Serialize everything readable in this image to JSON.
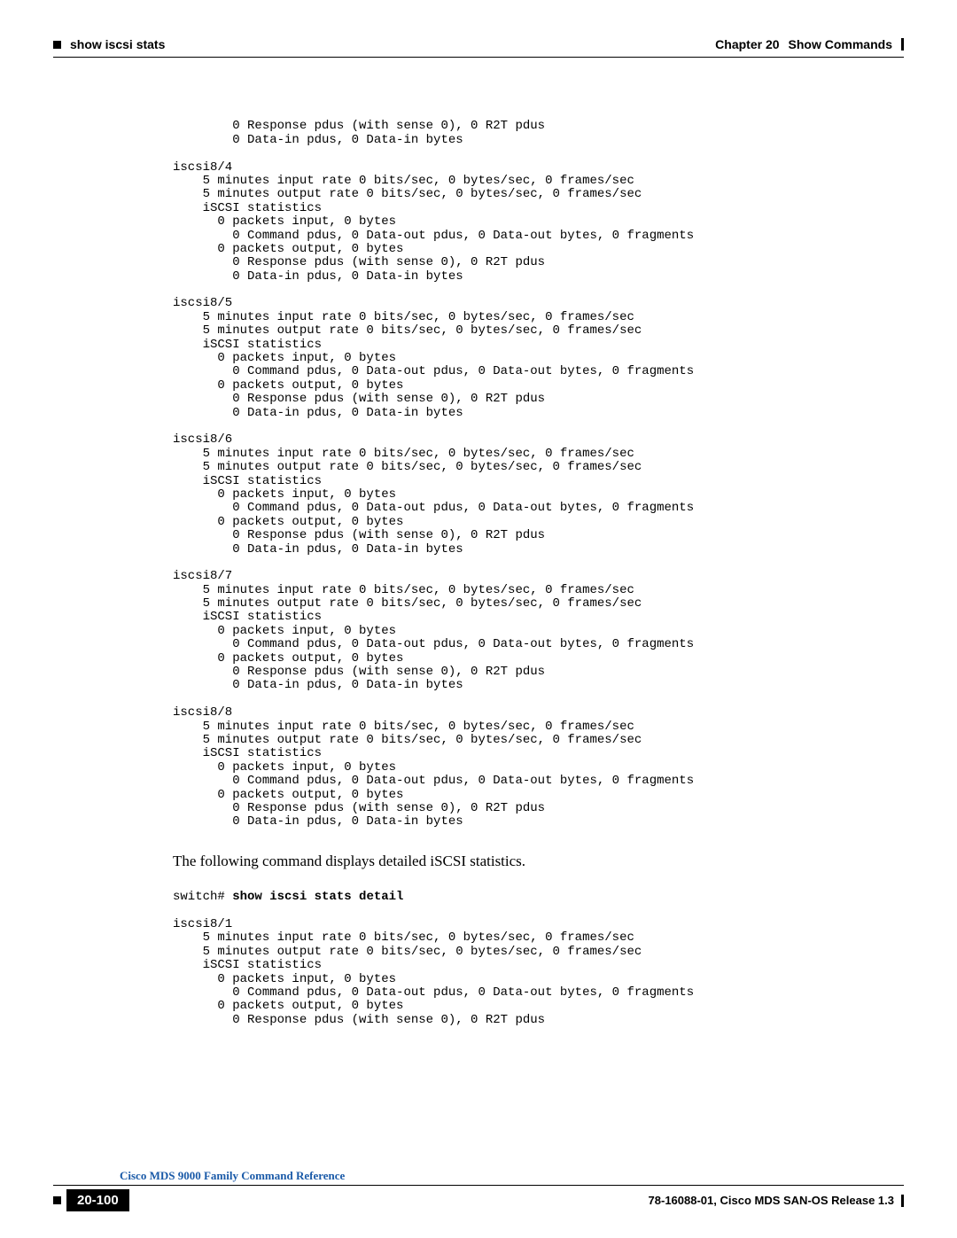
{
  "header": {
    "left_label": "show iscsi stats",
    "chapter_label": "Chapter 20",
    "chapter_title": "Show Commands"
  },
  "pre_block_top": "        0 Response pdus (with sense 0), 0 R2T pdus\n        0 Data-in pdus, 0 Data-in bytes\n\niscsi8/4\n    5 minutes input rate 0 bits/sec, 0 bytes/sec, 0 frames/sec\n    5 minutes output rate 0 bits/sec, 0 bytes/sec, 0 frames/sec\n    iSCSI statistics\n      0 packets input, 0 bytes\n        0 Command pdus, 0 Data-out pdus, 0 Data-out bytes, 0 fragments\n      0 packets output, 0 bytes\n        0 Response pdus (with sense 0), 0 R2T pdus\n        0 Data-in pdus, 0 Data-in bytes\n\niscsi8/5\n    5 minutes input rate 0 bits/sec, 0 bytes/sec, 0 frames/sec\n    5 minutes output rate 0 bits/sec, 0 bytes/sec, 0 frames/sec\n    iSCSI statistics\n      0 packets input, 0 bytes\n        0 Command pdus, 0 Data-out pdus, 0 Data-out bytes, 0 fragments\n      0 packets output, 0 bytes\n        0 Response pdus (with sense 0), 0 R2T pdus\n        0 Data-in pdus, 0 Data-in bytes\n\niscsi8/6\n    5 minutes input rate 0 bits/sec, 0 bytes/sec, 0 frames/sec\n    5 minutes output rate 0 bits/sec, 0 bytes/sec, 0 frames/sec\n    iSCSI statistics\n      0 packets input, 0 bytes\n        0 Command pdus, 0 Data-out pdus, 0 Data-out bytes, 0 fragments\n      0 packets output, 0 bytes\n        0 Response pdus (with sense 0), 0 R2T pdus\n        0 Data-in pdus, 0 Data-in bytes\n\niscsi8/7\n    5 minutes input rate 0 bits/sec, 0 bytes/sec, 0 frames/sec\n    5 minutes output rate 0 bits/sec, 0 bytes/sec, 0 frames/sec\n    iSCSI statistics\n      0 packets input, 0 bytes\n        0 Command pdus, 0 Data-out pdus, 0 Data-out bytes, 0 fragments\n      0 packets output, 0 bytes\n        0 Response pdus (with sense 0), 0 R2T pdus\n        0 Data-in pdus, 0 Data-in bytes\n\niscsi8/8\n    5 minutes input rate 0 bits/sec, 0 bytes/sec, 0 frames/sec\n    5 minutes output rate 0 bits/sec, 0 bytes/sec, 0 frames/sec\n    iSCSI statistics\n      0 packets input, 0 bytes\n        0 Command pdus, 0 Data-out pdus, 0 Data-out bytes, 0 fragments\n      0 packets output, 0 bytes\n        0 Response pdus (with sense 0), 0 R2T pdus\n        0 Data-in pdus, 0 Data-in bytes",
  "body_text": "The following command displays detailed iSCSI statistics.",
  "prompt_prefix": "switch# ",
  "prompt_command": "show iscsi stats detail",
  "pre_block_bottom": "iscsi8/1\n    5 minutes input rate 0 bits/sec, 0 bytes/sec, 0 frames/sec\n    5 minutes output rate 0 bits/sec, 0 bytes/sec, 0 frames/sec\n    iSCSI statistics\n      0 packets input, 0 bytes\n        0 Command pdus, 0 Data-out pdus, 0 Data-out bytes, 0 fragments\n      0 packets output, 0 bytes\n        0 Response pdus (with sense 0), 0 R2T pdus",
  "footer": {
    "doc_title": "Cisco MDS 9000 Family Command Reference",
    "page_number": "20-100",
    "doc_id": "78-16088-01, Cisco MDS SAN-OS Release 1.3"
  }
}
